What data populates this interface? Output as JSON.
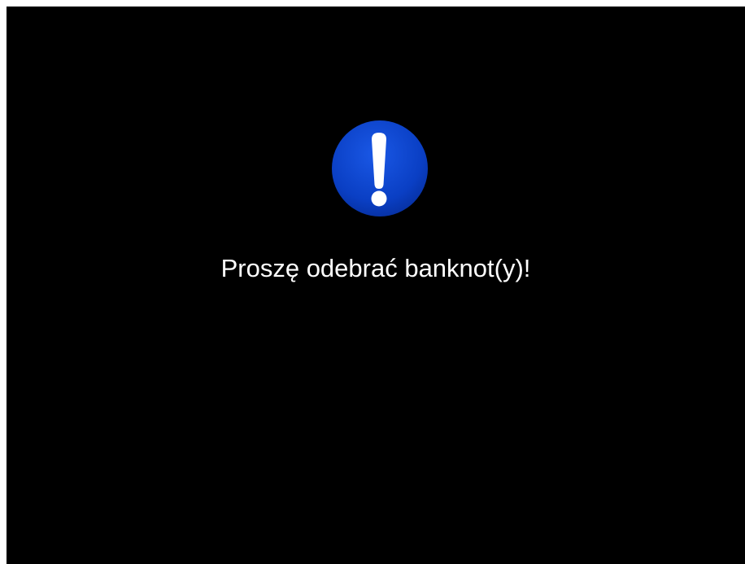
{
  "screen": {
    "background_color": "#000000",
    "icon": {
      "name": "exclamation-alert-icon",
      "circle_color": "#0a3fc4",
      "mark_color": "#ffffff"
    },
    "message": "Proszę odebrać banknot(y)!",
    "message_color": "#ffffff"
  }
}
